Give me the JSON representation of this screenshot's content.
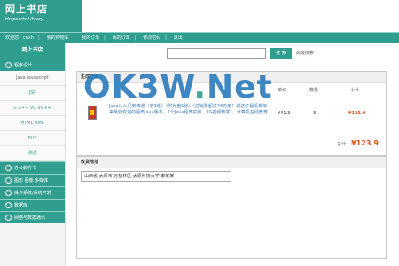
{
  "header": {
    "logo_title": "网上书店",
    "logo_subtitle": "Hogwarts Library"
  },
  "topnav": [
    "欢迎您：cnxh",
    "我的购物车",
    "我的订单",
    "我的订单",
    "修改密码",
    "退出"
  ],
  "sidebar": {
    "title": "网上书店",
    "groups": [
      {
        "label": "程序设计",
        "expanded": true,
        "items": [
          "Java Javascript",
          "JSP",
          "C C++ VC VC++",
          "HTML XML",
          "PHP",
          "测试"
        ]
      },
      {
        "label": "办公软件书"
      },
      {
        "label": "图形 图像 多媒体"
      },
      {
        "label": "操作系统/系统开发"
      },
      {
        "label": "数据库"
      },
      {
        "label": "网络与数据通讯"
      }
    ]
  },
  "search": {
    "placeholder": "",
    "button": "搜 索",
    "advanced": "高级搜索"
  },
  "order": {
    "title": "生成订单",
    "col_price": "单价",
    "col_qty": "数量",
    "col_subtotal": "小计",
    "item": {
      "name": "Java从入门到精通（第3版）（附光盘1张）（总销量超过40万册！讲述了最近数年来最受欢迎的经典Java版本，2个Java经典实例、3G视频教学），计算机在线教育",
      "price": "¥41.3",
      "qty": "3",
      "subtotal": "¥123.9"
    },
    "total_label": "总计:",
    "total": "¥123.9"
  },
  "address": {
    "title": "收货地址",
    "value": "山西省 太原市 万柏林区 太原科技大学 李某某"
  },
  "watermark": {
    "main": "OK3W",
    "dot": ".",
    "tail": "Net"
  },
  "colors": {
    "brand": "#2f9e8e",
    "price": "#e04f1e",
    "link": "#3b79b8"
  }
}
